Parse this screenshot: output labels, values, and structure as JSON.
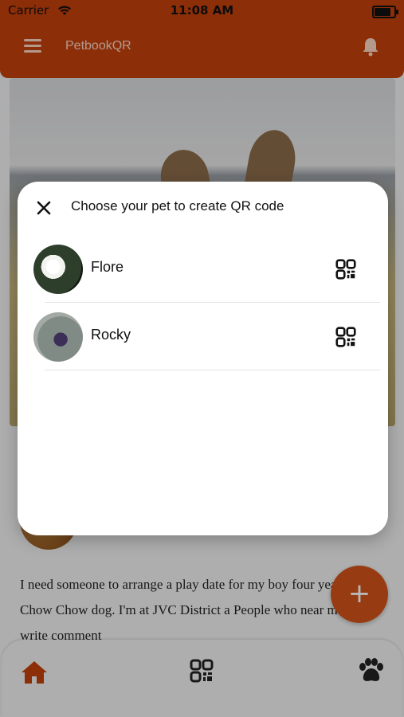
{
  "status_bar": {
    "carrier": "Carrier",
    "time": "11:08 AM"
  },
  "app_bar": {
    "title": "PetbookQR"
  },
  "feed": {
    "post_text": "I need someone to arrange a play date for my boy four year-old Chow Chow dog. I'm at JVC District a People who near me can write comment"
  },
  "dialog": {
    "title": "Choose your pet to create QR code",
    "pets": [
      {
        "name": "Flore"
      },
      {
        "name": "Rocky"
      }
    ]
  },
  "fab": {
    "label": "+"
  },
  "colors": {
    "brand": "#c2410c",
    "fab": "#d2541a"
  },
  "icons": {
    "menu": "hamburger-menu-icon",
    "notifications": "bell-icon",
    "close": "close-icon",
    "qr": "qr-code-icon",
    "home": "home-icon",
    "paw": "paw-icon",
    "wifi": "wifi-icon",
    "battery": "battery-icon"
  }
}
